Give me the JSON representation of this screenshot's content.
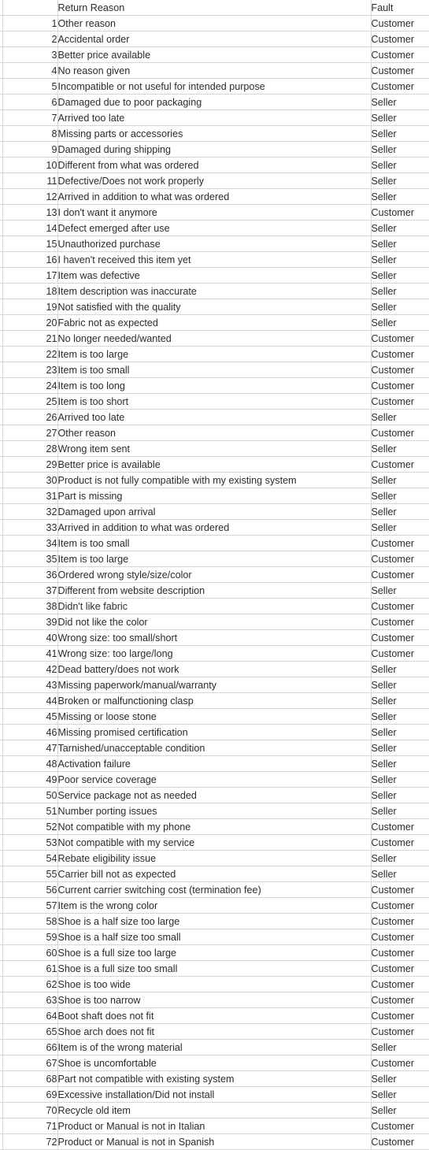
{
  "table": {
    "columns": {
      "gutter": "",
      "index": "",
      "reason": "Return Reason",
      "fault": "Fault"
    },
    "fault_values": [
      "Customer",
      "Seller"
    ],
    "rows": [
      {
        "index": "1",
        "reason": "Other reason",
        "fault": "Customer"
      },
      {
        "index": "2",
        "reason": "Accidental order",
        "fault": "Customer"
      },
      {
        "index": "3",
        "reason": "Better price available",
        "fault": "Customer"
      },
      {
        "index": "4",
        "reason": "No reason given",
        "fault": "Customer"
      },
      {
        "index": "5",
        "reason": "Incompatible or not useful for intended purpose",
        "fault": "Customer"
      },
      {
        "index": "6",
        "reason": "Damaged due to poor packaging",
        "fault": "Seller"
      },
      {
        "index": "7",
        "reason": "Arrived too late",
        "fault": "Seller"
      },
      {
        "index": "8",
        "reason": "Missing parts or accessories",
        "fault": "Seller"
      },
      {
        "index": "9",
        "reason": "Damaged during shipping",
        "fault": "Seller"
      },
      {
        "index": "10",
        "reason": "Different from what was ordered",
        "fault": "Seller"
      },
      {
        "index": "11",
        "reason": "Defective/Does not work properly",
        "fault": "Seller"
      },
      {
        "index": "12",
        "reason": "Arrived in addition to what was ordered",
        "fault": "Seller"
      },
      {
        "index": "13",
        "reason": "I don't want it anymore",
        "fault": "Customer"
      },
      {
        "index": "14",
        "reason": "Defect emerged after use",
        "fault": "Seller"
      },
      {
        "index": "15",
        "reason": "Unauthorized purchase",
        "fault": "Seller"
      },
      {
        "index": "16",
        "reason": "I haven't received this item yet",
        "fault": "Seller"
      },
      {
        "index": "17",
        "reason": "Item was defective",
        "fault": "Seller"
      },
      {
        "index": "18",
        "reason": "Item description was inaccurate",
        "fault": "Seller"
      },
      {
        "index": "19",
        "reason": "Not satisfied with the quality",
        "fault": "Seller"
      },
      {
        "index": "20",
        "reason": "Fabric not as expected",
        "fault": "Seller"
      },
      {
        "index": "21",
        "reason": "No longer needed/wanted",
        "fault": "Customer"
      },
      {
        "index": "22",
        "reason": "Item is too large",
        "fault": "Customer"
      },
      {
        "index": "23",
        "reason": "Item is too small",
        "fault": "Customer"
      },
      {
        "index": "24",
        "reason": "Item is too long",
        "fault": "Customer"
      },
      {
        "index": "25",
        "reason": "Item is too short",
        "fault": "Customer"
      },
      {
        "index": "26",
        "reason": "Arrived too late",
        "fault": "Seller"
      },
      {
        "index": "27",
        "reason": "Other reason",
        "fault": "Customer"
      },
      {
        "index": "28",
        "reason": "Wrong item sent",
        "fault": "Seller"
      },
      {
        "index": "29",
        "reason": "Better price is available",
        "fault": "Customer"
      },
      {
        "index": "30",
        "reason": "Product is not fully compatible with my existing system",
        "fault": "Seller"
      },
      {
        "index": "31",
        "reason": "Part is missing",
        "fault": "Seller"
      },
      {
        "index": "32",
        "reason": "Damaged upon arrival",
        "fault": "Seller"
      },
      {
        "index": "33",
        "reason": "Arrived in addition to what was ordered",
        "fault": "Seller"
      },
      {
        "index": "34",
        "reason": "Item is too small",
        "fault": "Customer"
      },
      {
        "index": "35",
        "reason": "Item is too large",
        "fault": "Customer"
      },
      {
        "index": "36",
        "reason": "Ordered wrong style/size/color",
        "fault": "Customer"
      },
      {
        "index": "37",
        "reason": "Different from website description",
        "fault": "Seller"
      },
      {
        "index": "38",
        "reason": "Didn't like fabric",
        "fault": "Customer"
      },
      {
        "index": "39",
        "reason": "Did not like the color",
        "fault": "Customer"
      },
      {
        "index": "40",
        "reason": "Wrong size: too small/short",
        "fault": "Customer"
      },
      {
        "index": "41",
        "reason": "Wrong size: too large/long",
        "fault": "Customer"
      },
      {
        "index": "42",
        "reason": "Dead battery/does not work",
        "fault": "Seller"
      },
      {
        "index": "43",
        "reason": "Missing paperwork/manual/warranty",
        "fault": "Seller"
      },
      {
        "index": "44",
        "reason": "Broken or malfunctioning clasp",
        "fault": "Seller"
      },
      {
        "index": "45",
        "reason": "Missing or loose stone",
        "fault": "Seller"
      },
      {
        "index": "46",
        "reason": "Missing promised certification",
        "fault": "Seller"
      },
      {
        "index": "47",
        "reason": "Tarnished/unacceptable condition",
        "fault": "Seller"
      },
      {
        "index": "48",
        "reason": "Activation failure",
        "fault": "Seller"
      },
      {
        "index": "49",
        "reason": "Poor service coverage",
        "fault": "Seller"
      },
      {
        "index": "50",
        "reason": "Service package not as needed",
        "fault": "Seller"
      },
      {
        "index": "51",
        "reason": "Number porting issues",
        "fault": "Seller"
      },
      {
        "index": "52",
        "reason": "Not compatible with my phone",
        "fault": "Customer"
      },
      {
        "index": "53",
        "reason": "Not compatible with my service",
        "fault": "Customer"
      },
      {
        "index": "54",
        "reason": "Rebate eligibility issue",
        "fault": "Seller"
      },
      {
        "index": "55",
        "reason": "Carrier bill not as expected",
        "fault": "Seller"
      },
      {
        "index": "56",
        "reason": "Current carrier switching cost (termination fee)",
        "fault": "Customer"
      },
      {
        "index": "57",
        "reason": "Item is the wrong color",
        "fault": "Customer"
      },
      {
        "index": "58",
        "reason": "Shoe is a half size too large",
        "fault": "Customer"
      },
      {
        "index": "59",
        "reason": "Shoe is a half size too small",
        "fault": "Customer"
      },
      {
        "index": "60",
        "reason": "Shoe is a full size too large",
        "fault": "Customer"
      },
      {
        "index": "61",
        "reason": "Shoe is a full size too small",
        "fault": "Customer"
      },
      {
        "index": "62",
        "reason": "Shoe is too wide",
        "fault": "Customer"
      },
      {
        "index": "63",
        "reason": "Shoe is too narrow",
        "fault": "Customer"
      },
      {
        "index": "64",
        "reason": "Boot shaft does not fit",
        "fault": "Customer"
      },
      {
        "index": "65",
        "reason": "Shoe arch does not fit",
        "fault": "Customer"
      },
      {
        "index": "66",
        "reason": "Item is of the wrong material",
        "fault": "Seller"
      },
      {
        "index": "67",
        "reason": "Shoe is uncomfortable",
        "fault": "Customer"
      },
      {
        "index": "68",
        "reason": "Part not compatible with existing system",
        "fault": "Seller"
      },
      {
        "index": "69",
        "reason": "Excessive installation/Did not install",
        "fault": "Seller"
      },
      {
        "index": "70",
        "reason": "Recycle old item",
        "fault": "Seller"
      },
      {
        "index": "71",
        "reason": "Product or Manual is not in Italian",
        "fault": "Customer"
      },
      {
        "index": "72",
        "reason": "Product or Manual is not in Spanish",
        "fault": "Customer"
      }
    ]
  },
  "style": {
    "grid_line_color": "#d6d6d6",
    "text_color": "#2b2b2b",
    "background_color": "#ffffff"
  }
}
